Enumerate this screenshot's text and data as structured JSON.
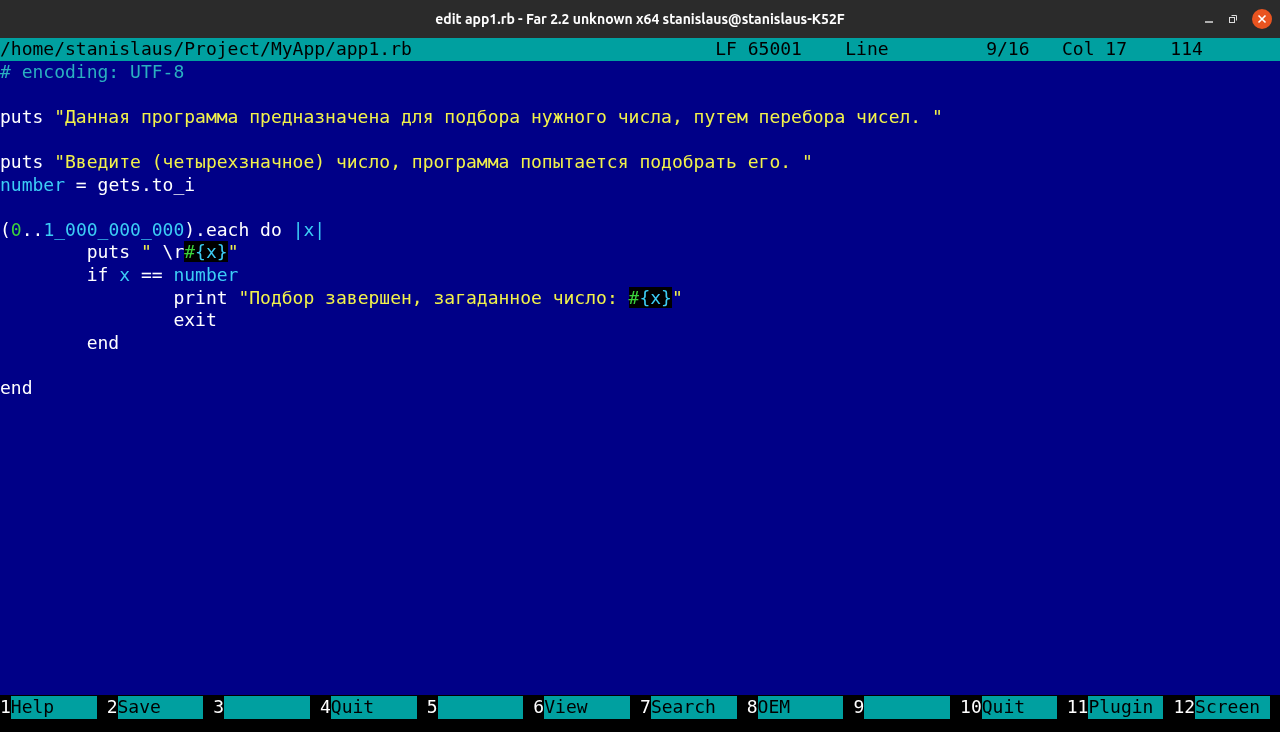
{
  "window": {
    "title": "edit app1.rb - Far 2.2 unknown x64 stanislaus@stanislaus-K52F"
  },
  "status_bar": {
    "path": "/home/stanislaus/Project/MyApp/app1.rb",
    "codepage": "LF 65001",
    "mode": "Line",
    "line": "9/16",
    "column": "Col 17",
    "char_code": "114"
  },
  "code_lines": [
    {
      "kind": "code",
      "tokens": [
        {
          "kind": "comment",
          "text": "# encoding: UTF-8"
        }
      ]
    },
    {
      "kind": "blank"
    },
    {
      "kind": "code",
      "tokens": [
        {
          "kind": "plain",
          "text": "puts "
        },
        {
          "kind": "string",
          "text": "\"Данная программа предназначена для подбора нужного числа, путем перебора чисел. \""
        }
      ]
    },
    {
      "kind": "blank"
    },
    {
      "kind": "code",
      "tokens": [
        {
          "kind": "plain",
          "text": "puts "
        },
        {
          "kind": "string",
          "text": "\"Введите (четырехзначное) число, программа попытается подобрать его. \""
        }
      ]
    },
    {
      "kind": "code",
      "tokens": [
        {
          "kind": "ident",
          "text": "number"
        },
        {
          "kind": "plain",
          "text": " = gets.to_i"
        }
      ]
    },
    {
      "kind": "blank"
    },
    {
      "kind": "code",
      "tokens": [
        {
          "kind": "plain",
          "text": "("
        },
        {
          "kind": "zero",
          "text": "0"
        },
        {
          "kind": "plain",
          "text": ".."
        },
        {
          "kind": "ident",
          "text": "1_000_000_000"
        },
        {
          "kind": "plain",
          "text": ").each do "
        },
        {
          "kind": "ident",
          "text": "|x|"
        }
      ]
    },
    {
      "kind": "code",
      "tokens": [
        {
          "kind": "plain",
          "text": "        puts "
        },
        {
          "kind": "string",
          "text": "\" "
        },
        {
          "kind": "plain",
          "text": "\\r"
        },
        {
          "kind": "interp_hash",
          "text": "#"
        },
        {
          "kind": "interp",
          "text": "{x}"
        },
        {
          "kind": "string",
          "text": "\""
        }
      ]
    },
    {
      "kind": "code",
      "tokens": [
        {
          "kind": "plain",
          "text": "        if "
        },
        {
          "kind": "ident",
          "text": "x"
        },
        {
          "kind": "plain",
          "text": " == "
        },
        {
          "kind": "ident",
          "text": "number"
        }
      ]
    },
    {
      "kind": "code",
      "tokens": [
        {
          "kind": "plain",
          "text": "                print "
        },
        {
          "kind": "string",
          "text": "\"Подбор завершен, загаданное число: "
        },
        {
          "kind": "interp_hash",
          "text": "#"
        },
        {
          "kind": "interp",
          "text": "{x}"
        },
        {
          "kind": "string",
          "text": "\""
        }
      ]
    },
    {
      "kind": "code",
      "tokens": [
        {
          "kind": "plain",
          "text": "                exit"
        }
      ]
    },
    {
      "kind": "code",
      "tokens": [
        {
          "kind": "plain",
          "text": "        end"
        }
      ]
    },
    {
      "kind": "blank"
    },
    {
      "kind": "code",
      "tokens": [
        {
          "kind": "plain",
          "text": "end"
        }
      ]
    }
  ],
  "key_bar": [
    {
      "key": "1",
      "label": "Help"
    },
    {
      "key": "2",
      "label": "Save"
    },
    {
      "key": "3"
    },
    {
      "key": "4",
      "label": "Quit"
    },
    {
      "key": "5"
    },
    {
      "key": "6",
      "label": "View"
    },
    {
      "key": "7",
      "label": "Search"
    },
    {
      "key": "8",
      "label": "OEM"
    },
    {
      "key": "9"
    },
    {
      "key": "10",
      "label": "Quit"
    },
    {
      "key": "11",
      "label": "Plugin"
    },
    {
      "key": "12",
      "label": "Screen"
    }
  ]
}
